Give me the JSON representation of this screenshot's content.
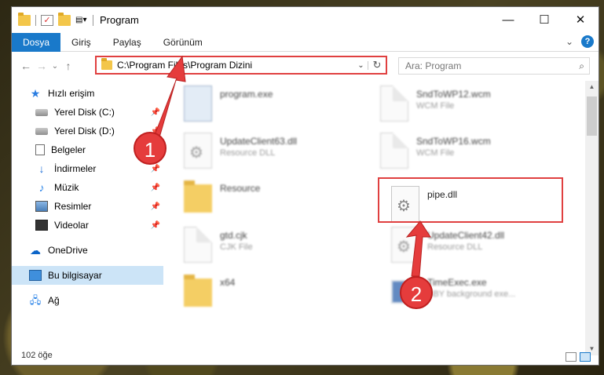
{
  "window": {
    "title": "Program",
    "controls": {
      "minimize": "—",
      "maximize": "☐",
      "close": "✕"
    }
  },
  "ribbon": {
    "tabs": [
      "Dosya",
      "Giriş",
      "Paylaş",
      "Görünüm"
    ],
    "expand": "⌄",
    "help": "?"
  },
  "address_bar": {
    "path": "C:\\Program Files\\Program Dizini",
    "chevron": "⌄",
    "refresh": "↻",
    "highlight_color": "#e04040"
  },
  "search": {
    "placeholder": "Ara: Program",
    "icon": "⌕"
  },
  "nav": {
    "back": "←",
    "forward": "→",
    "recent": "⌄",
    "up": "↑",
    "items": [
      {
        "label": "Hızlı erişim",
        "icon": "star-icon",
        "pinned": false
      },
      {
        "label": "Yerel Disk (C:)",
        "icon": "drive-icon",
        "pinned": true
      },
      {
        "label": "Yerel Disk (D:)",
        "icon": "drive-icon",
        "pinned": true
      },
      {
        "label": "Belgeler",
        "icon": "documents-icon",
        "pinned": true
      },
      {
        "label": "İndirmeler",
        "icon": "download-icon",
        "pinned": true
      },
      {
        "label": "Müzik",
        "icon": "music-icon",
        "pinned": true
      },
      {
        "label": "Resimler",
        "icon": "pictures-icon",
        "pinned": true
      },
      {
        "label": "Videolar",
        "icon": "videos-icon",
        "pinned": true
      },
      {
        "label": "OneDrive",
        "icon": "onedrive-icon",
        "pinned": false
      },
      {
        "label": "Bu bilgisayar",
        "icon": "this-pc-icon",
        "pinned": false,
        "selected": true
      },
      {
        "label": "Ağ",
        "icon": "network-icon",
        "pinned": false
      }
    ]
  },
  "files": [
    {
      "name": "program.exe",
      "type": "",
      "icon": "exe-icon"
    },
    {
      "name": "SndToWP12.wcm",
      "type": "WCM File",
      "icon": "generic-file-icon"
    },
    {
      "name": "UpdateClient63.dll",
      "type": "Resource DLL",
      "icon": "gear-file-icon"
    },
    {
      "name": "SndToWP16.wcm",
      "type": "WCM File",
      "icon": "generic-file-icon"
    },
    {
      "name": "Resource",
      "type": "",
      "icon": "folder-icon"
    },
    {
      "name": "pipe.dll",
      "type": "",
      "icon": "gear-file-icon"
    },
    {
      "name": "gtd.cjk",
      "type": "CJK File",
      "icon": "generic-file-icon"
    },
    {
      "name": "UpdateClient42.dll",
      "type": "Resource DLL",
      "icon": "gear-file-icon"
    },
    {
      "name": "x64",
      "type": "",
      "icon": "folder-icon"
    },
    {
      "name": "TimeExec.exe",
      "type": "SBY background exe...",
      "icon": "monitor-exe-icon"
    }
  ],
  "status": {
    "item_count": "102 öğe"
  },
  "annotations": {
    "step1": "1",
    "step2": "2",
    "color": "#e53c3c"
  }
}
